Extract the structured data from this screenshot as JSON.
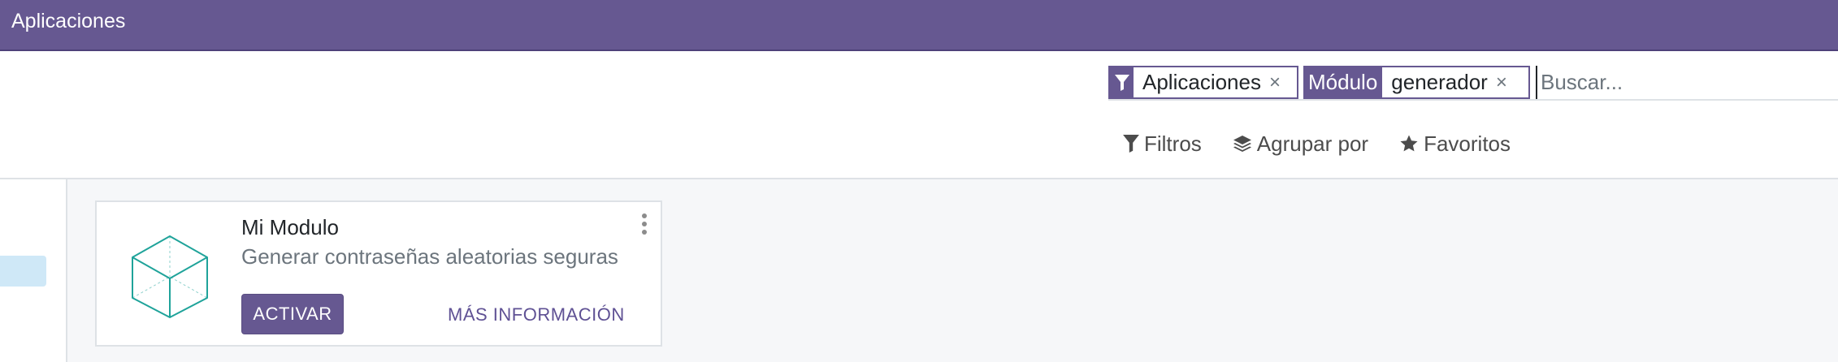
{
  "navbar": {
    "app_title": "Aplicaciones",
    "color": "#665891"
  },
  "search": {
    "facets": [
      {
        "icon": "filter-icon",
        "value": "Aplicaciones"
      },
      {
        "title": "Módulo",
        "value": "generador"
      }
    ],
    "remove_glyph": "×",
    "placeholder": "Buscar..."
  },
  "filters_bar": {
    "filters_label": "Filtros",
    "groupby_label": "Agrupar por",
    "favorites_label": "Favoritos"
  },
  "module_card": {
    "name": "Mi Modulo",
    "summary": "Generar contraseñas aleatorias seguras",
    "activate_label": "ACTIVAR",
    "info_label": "MÁS INFORMACIÓN",
    "icon": "cube-icon"
  },
  "colors": {
    "accent": "#665891",
    "sidebar_selected": "#cfe8f7",
    "cube": "#1fa39a"
  }
}
